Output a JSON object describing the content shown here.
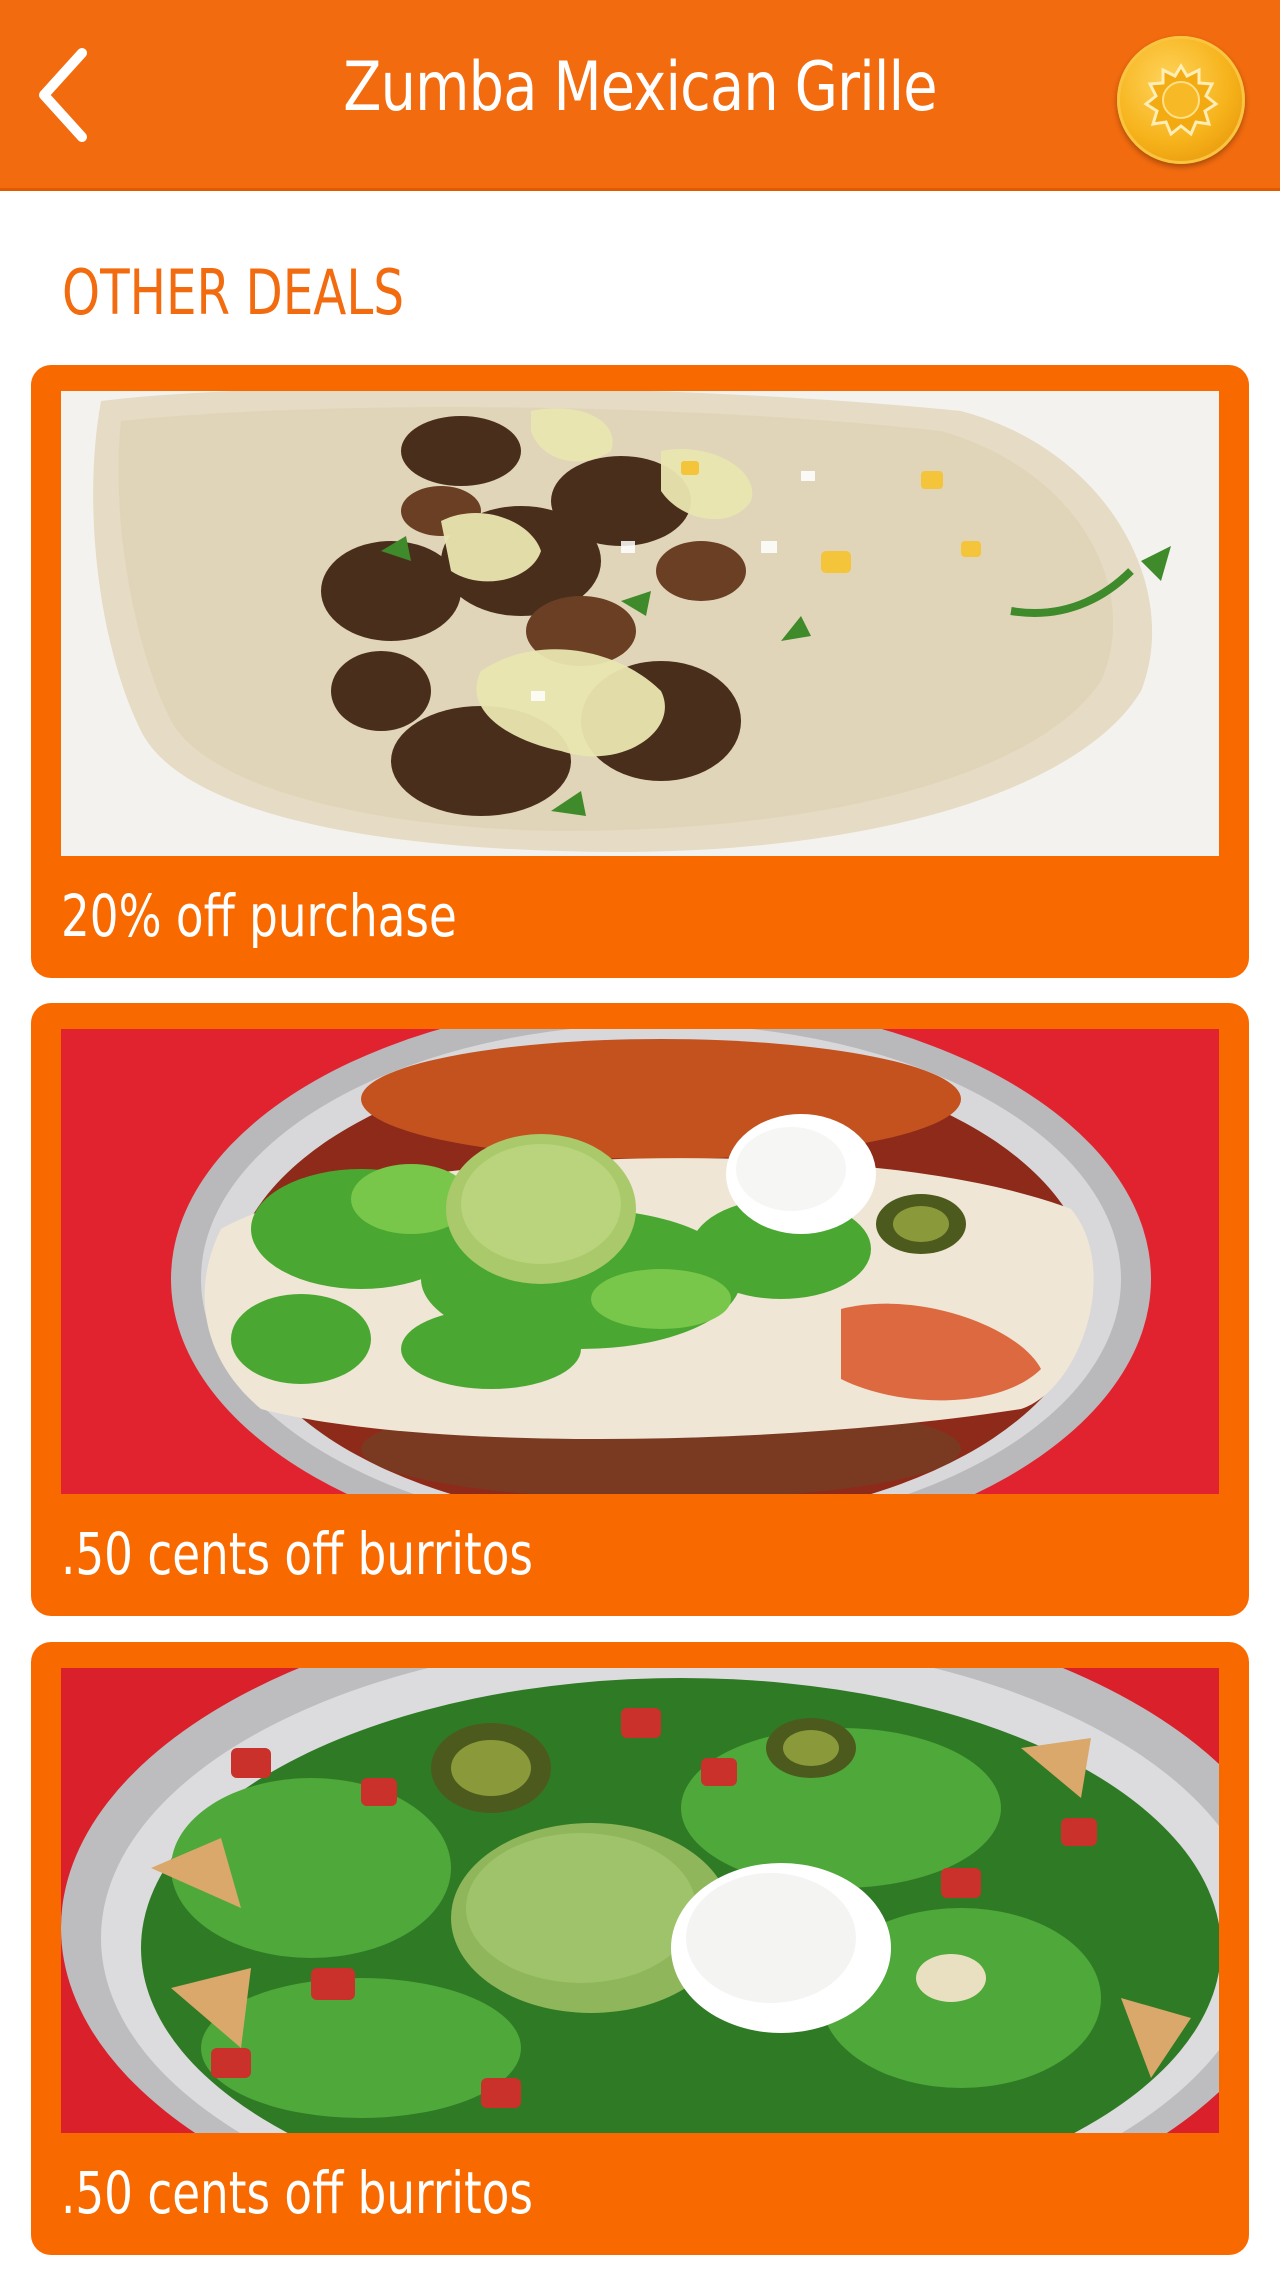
{
  "header": {
    "title": "Zumba Mexican Grille",
    "back_icon": "chevron-left-icon",
    "coin_icon": "reward-coin-icon",
    "background_color": "#f26b0f"
  },
  "section": {
    "title": "OTHER DEALS"
  },
  "deals": [
    {
      "label": "20% off purchase",
      "photo": "taco-photo"
    },
    {
      "label": ".50 cents off burritos",
      "photo": "burrito-photo"
    },
    {
      "label": ".50 cents off burritos",
      "photo": "nachos-photo"
    }
  ],
  "colors": {
    "accent": "#f26b0f",
    "card": "#f86a00",
    "text_on_accent": "#ffffff"
  }
}
